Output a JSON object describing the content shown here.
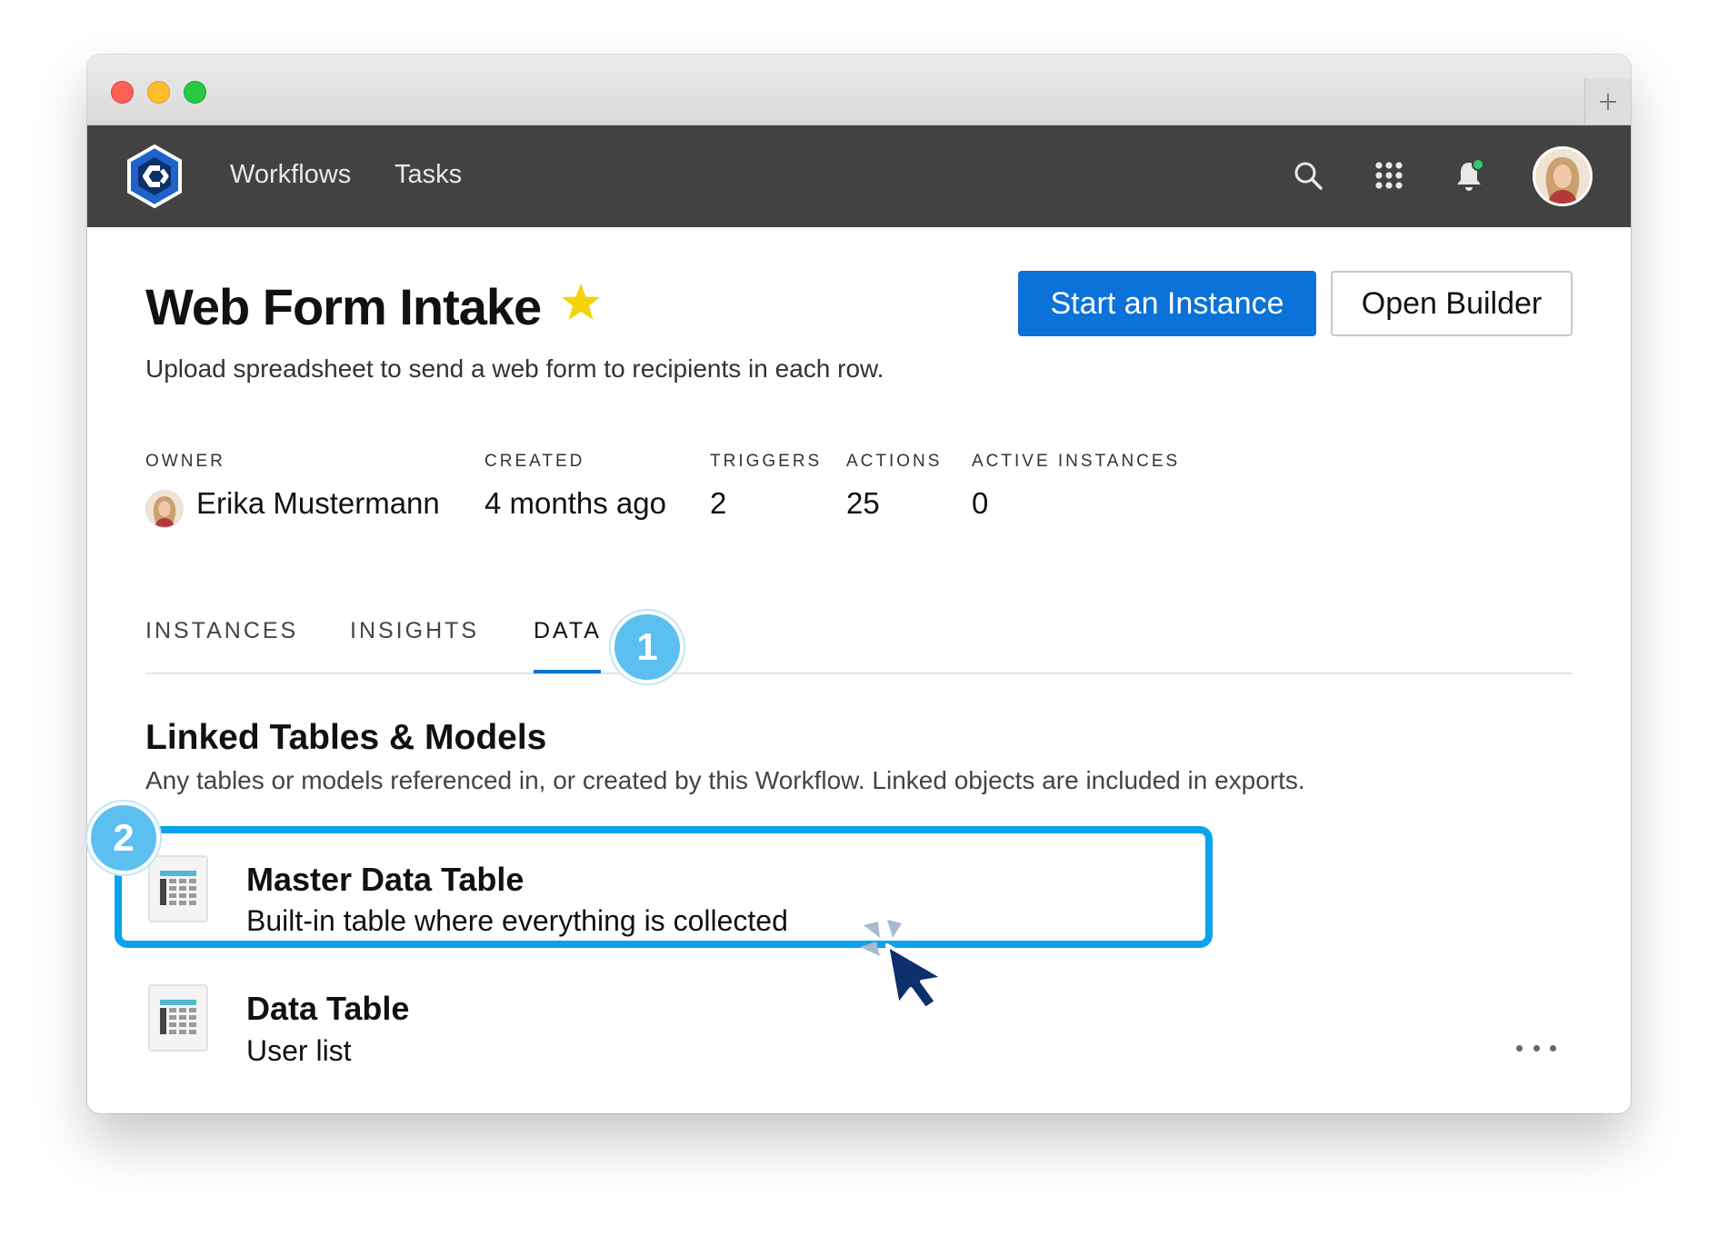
{
  "nav": {
    "links": [
      "Workflows",
      "Tasks"
    ]
  },
  "workflow": {
    "title": "Web Form Intake",
    "subtitle": "Upload spreadsheet to send a web form to recipients in each row.",
    "starred": true
  },
  "actions": {
    "primary": "Start an Instance",
    "secondary": "Open Builder"
  },
  "meta": [
    {
      "label": "OWNER",
      "value": "Erika Mustermann"
    },
    {
      "label": "CREATED",
      "value": "4 months ago"
    },
    {
      "label": "TRIGGERS",
      "value": "2"
    },
    {
      "label": "ACTIONS",
      "value": "25"
    },
    {
      "label": "ACTIVE INSTANCES",
      "value": "0"
    }
  ],
  "tabs": [
    {
      "label": "INSTANCES",
      "active": false
    },
    {
      "label": "INSIGHTS",
      "active": false
    },
    {
      "label": "DATA",
      "active": true
    }
  ],
  "section": {
    "title": "Linked Tables & Models",
    "description": "Any tables or models referenced in, or created by this Workflow. Linked objects are included in exports."
  },
  "tables": [
    {
      "name": "Master Data Table",
      "description": "Built-in table where everything is collected",
      "highlighted": true
    },
    {
      "name": "Data Table",
      "description": "User list",
      "highlighted": false
    }
  ],
  "callouts": [
    "1",
    "2"
  ],
  "icons": {
    "logo": "app-logo-icon",
    "search": "search-icon",
    "apps": "apps-grid-icon",
    "notifications": "bell-icon",
    "table": "table-icon",
    "more": "more-horizontal-icon",
    "star": "star-icon",
    "cursor": "cursor-click-icon"
  },
  "colors": {
    "navbar": "#424242",
    "primary": "#0a72d8",
    "highlight": "#09a2ec",
    "badge": "#5bc0f0",
    "star": "#f5d20b",
    "notification_dot": "#2ecc71"
  }
}
